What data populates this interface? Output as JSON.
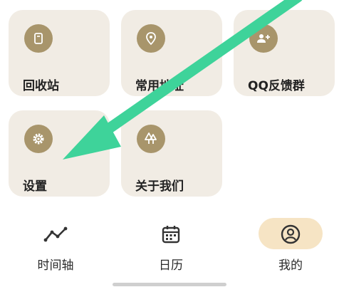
{
  "tiles": [
    {
      "label": "回收站",
      "icon": "trash-icon"
    },
    {
      "label": "常用地址",
      "icon": "location-pin-icon"
    },
    {
      "label": "QQ反馈群",
      "icon": "group-add-icon"
    },
    {
      "label": "设置",
      "icon": "gear-icon"
    },
    {
      "label": "关于我们",
      "icon": "trees-icon"
    }
  ],
  "bottom_nav": [
    {
      "label": "时间轴",
      "icon": "timeline-icon",
      "selected": false
    },
    {
      "label": "日历",
      "icon": "calendar-icon",
      "selected": false
    },
    {
      "label": "我的",
      "icon": "profile-icon",
      "selected": true
    }
  ],
  "colors": {
    "tile_bg": "#f1ece4",
    "icon_bg": "#a8956b",
    "selected_pill": "#f6e4c4",
    "annotation_arrow": "#3ed39a"
  }
}
